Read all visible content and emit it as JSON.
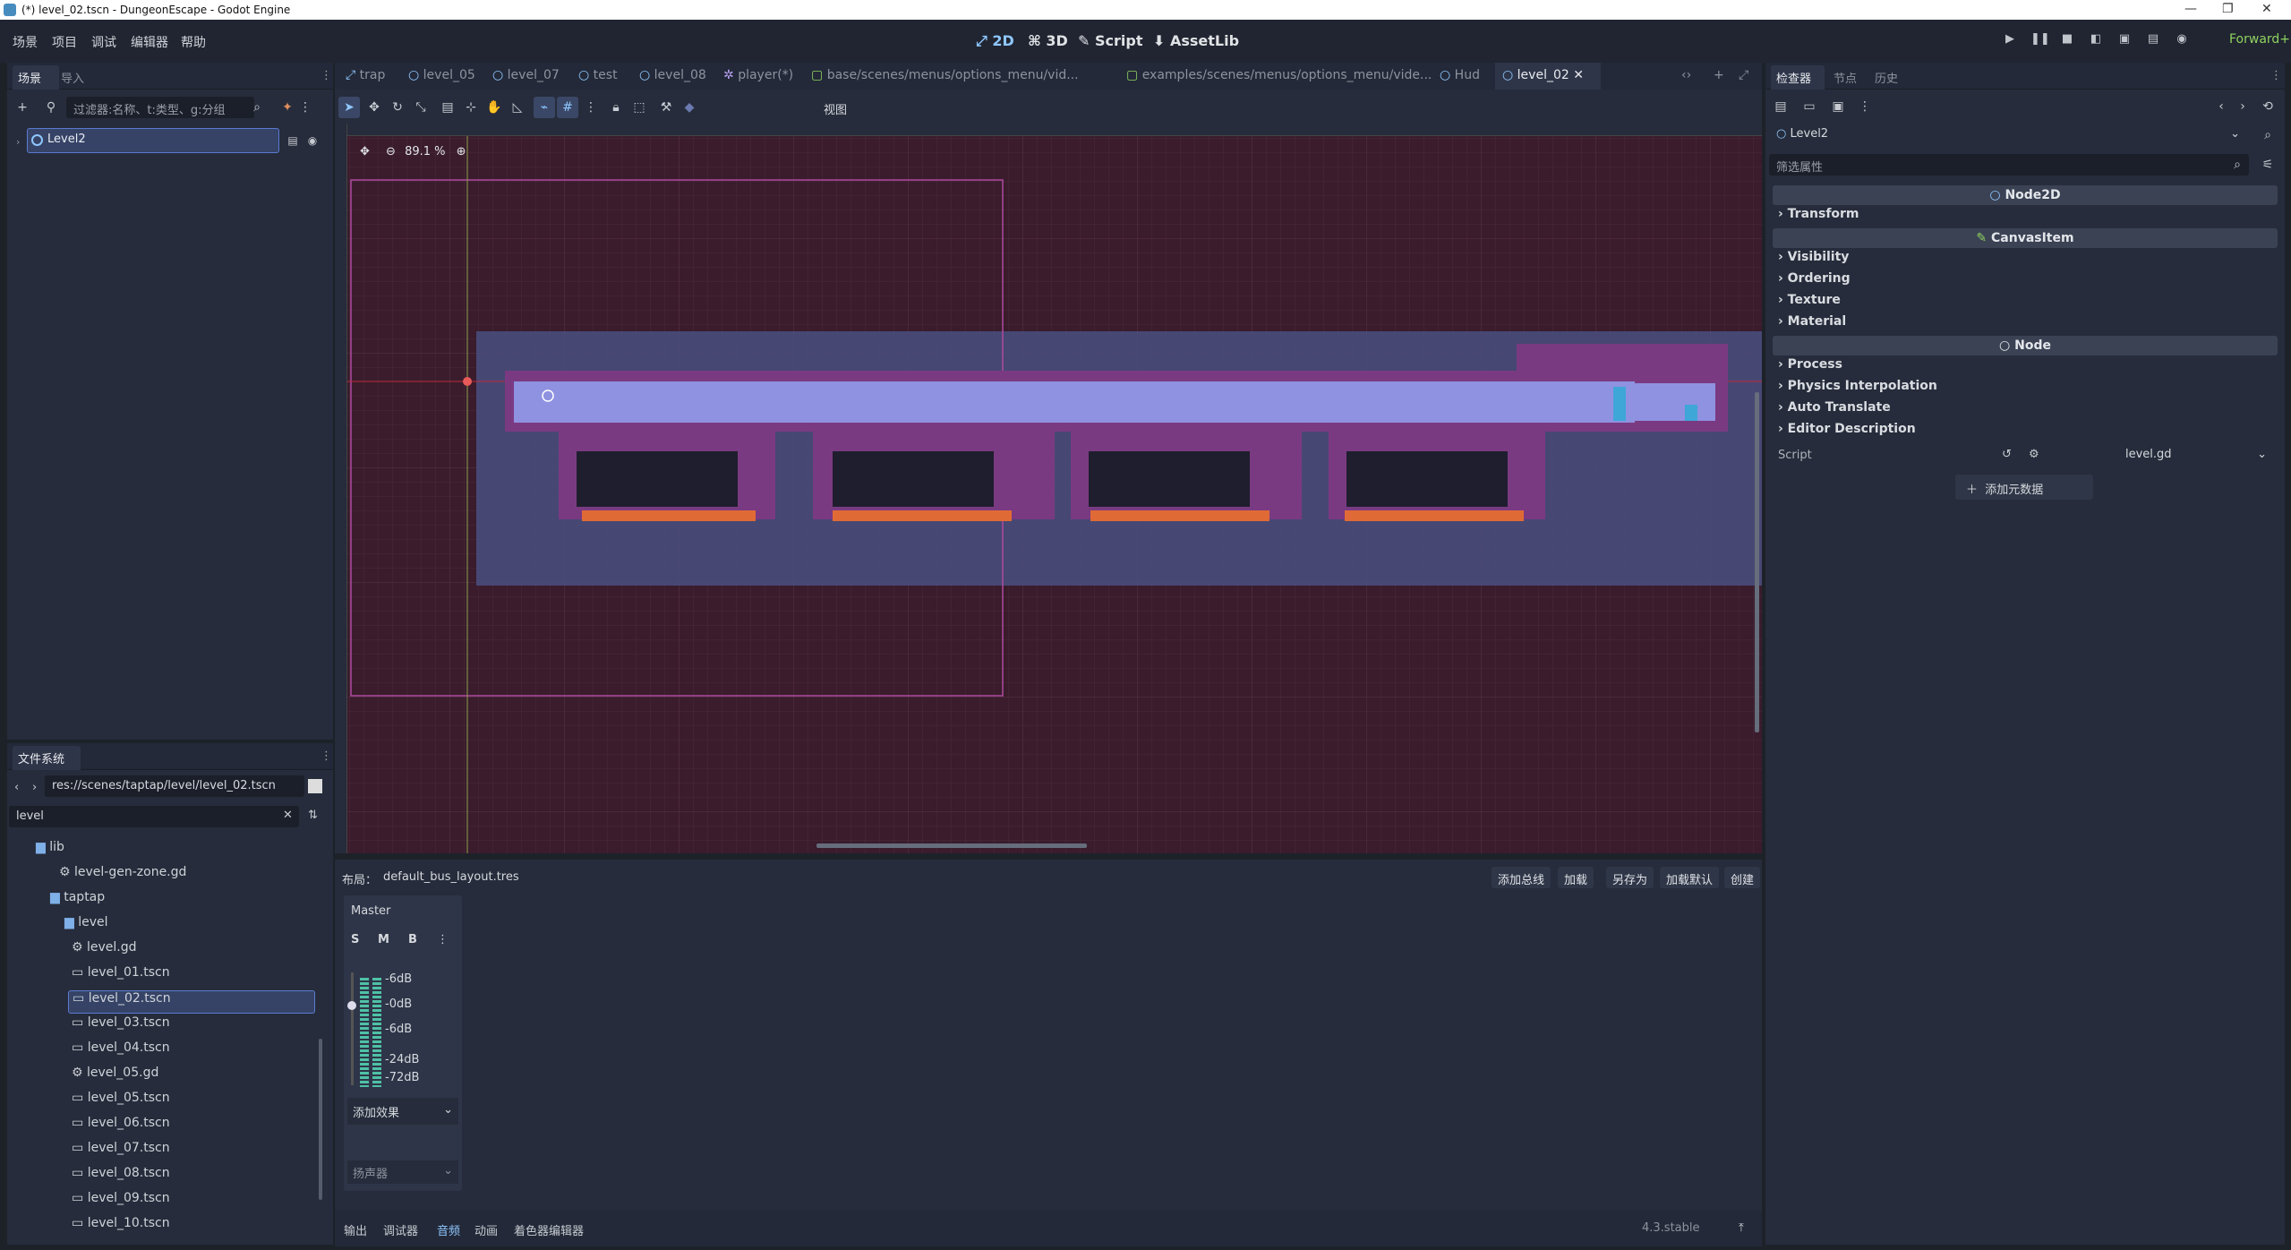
{
  "window": {
    "title": "(*) level_02.tscn - DungeonEscape - Godot Engine"
  },
  "menu": {
    "items": [
      "场景",
      "项目",
      "调试",
      "编辑器",
      "帮助"
    ]
  },
  "modes": {
    "m2d": "2D",
    "m3d": "3D",
    "script": "Script",
    "assetlib": "AssetLib"
  },
  "renderer": "Forward+",
  "scene_dock": {
    "tabs": [
      "场景",
      "导入"
    ],
    "filter_placeholder": "过滤器:名称、t:类型、g:分组",
    "root_node": "Level2"
  },
  "filesystem": {
    "tab": "文件系统",
    "path": "res://scenes/taptap/level/level_02.tscn",
    "search": "level",
    "items": [
      {
        "name": "lib",
        "kind": "folder"
      },
      {
        "name": "level-gen-zone.gd",
        "kind": "script"
      },
      {
        "name": "taptap",
        "kind": "folder"
      },
      {
        "name": "level",
        "kind": "folder"
      },
      {
        "name": "level.gd",
        "kind": "script"
      },
      {
        "name": "level_01.tscn",
        "kind": "scene"
      },
      {
        "name": "level_02.tscn",
        "kind": "scene",
        "selected": true
      },
      {
        "name": "level_03.tscn",
        "kind": "scene"
      },
      {
        "name": "level_04.tscn",
        "kind": "scene"
      },
      {
        "name": "level_05.gd",
        "kind": "script"
      },
      {
        "name": "level_05.tscn",
        "kind": "scene"
      },
      {
        "name": "level_06.tscn",
        "kind": "scene"
      },
      {
        "name": "level_07.tscn",
        "kind": "scene"
      },
      {
        "name": "level_08.tscn",
        "kind": "scene"
      },
      {
        "name": "level_09.tscn",
        "kind": "scene"
      },
      {
        "name": "level_10.tscn",
        "kind": "scene"
      }
    ]
  },
  "editor_tabs": [
    "trap",
    "level_05",
    "level_07",
    "test",
    "level_08",
    "player(*)",
    "base/scenes/menus/options_menu/vid...",
    "examples/scenes/menus/options_menu/vide...",
    "Hud",
    "level_02"
  ],
  "toolbar": {
    "view": "视图",
    "zoom": "89.1 %"
  },
  "audio": {
    "layout_label": "布局：",
    "layout_file": "default_bus_layout.tres",
    "buttons": [
      "添加总线",
      "加载",
      "另存为",
      "加载默认",
      "创建"
    ],
    "bus_name": "Master",
    "bus_buttons": [
      "S",
      "M",
      "B"
    ],
    "db_labels": [
      "-6dB",
      "-0dB",
      "-6dB",
      "-24dB",
      "-72dB"
    ],
    "add_effect": "添加效果",
    "output": "扬声器"
  },
  "bottom_tabs": [
    "输出",
    "调试器",
    "音频",
    "动画",
    "着色器编辑器"
  ],
  "version": "4.3.stable",
  "inspector": {
    "tabs": [
      "检查器",
      "节点",
      "历史"
    ],
    "node": "Level2",
    "filter_placeholder": "筛选属性",
    "sections": [
      {
        "title": "Node2D",
        "items": [
          "Transform"
        ]
      },
      {
        "title": "CanvasItem",
        "items": [
          "Visibility",
          "Ordering",
          "Texture",
          "Material"
        ]
      },
      {
        "title": "Node",
        "items": [
          "Process",
          "Physics Interpolation",
          "Auto Translate",
          "Editor Description"
        ]
      }
    ],
    "script_label": "Script",
    "script_value": "level.gd",
    "add_metadata": "添加元数据"
  },
  "colors": {
    "accent": "#8fc7ff",
    "bg": "#262c3b",
    "viewport": "#3a1c2c",
    "room": "#8c8cd8",
    "wall": "#8a3e88",
    "lava": "#e06a36"
  }
}
